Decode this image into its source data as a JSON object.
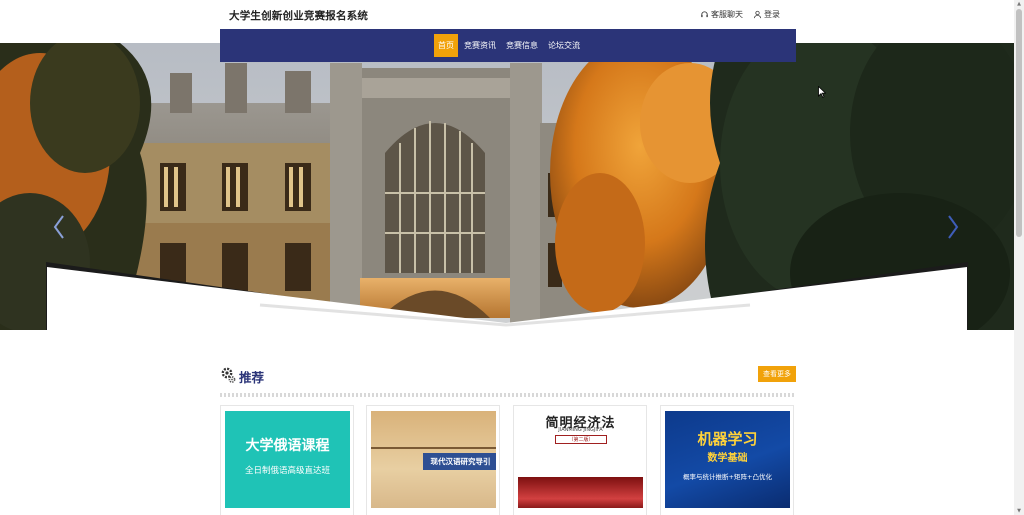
{
  "header": {
    "site_title": "大学生创新创业竞赛报名系统",
    "service_label": "客服聊天",
    "login_label": "登录"
  },
  "nav": {
    "items": [
      {
        "label": "首页",
        "active": true
      },
      {
        "label": "竞赛资讯",
        "active": false
      },
      {
        "label": "竞赛信息",
        "active": false
      },
      {
        "label": "论坛交流",
        "active": false
      }
    ]
  },
  "section": {
    "title": "推荐",
    "more_label": "查看更多"
  },
  "cards": [
    {
      "line1": "大学俄语课程",
      "line2": "全日制俄语高级直达班"
    },
    {
      "band": "现代汉语研究导引"
    },
    {
      "title": "简明经济法",
      "pinyin": "JIANMING JINGJIFA",
      "edition": "（第二版）"
    },
    {
      "title": "机器学习",
      "subtitle": "数学基础",
      "caption": "概率与统计推断+矩阵+凸优化"
    }
  ],
  "colors": {
    "nav_bg": "#2b3478",
    "accent": "#f1a20a",
    "title_color": "#2b3478"
  },
  "icons": {
    "service": "headset-icon",
    "login": "user-icon",
    "section": "gear-icon",
    "prev": "chevron-left-icon",
    "next": "chevron-right-icon"
  }
}
